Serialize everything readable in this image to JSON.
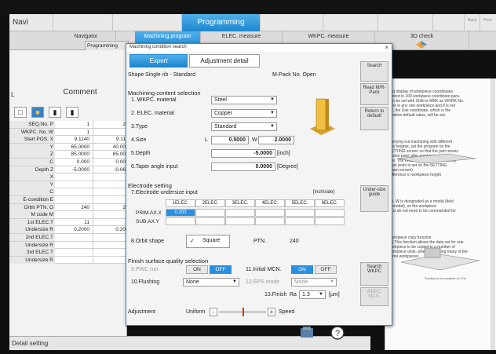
{
  "top_tabs": [
    "Navi",
    "",
    "",
    "",
    "Programming",
    "",
    "",
    "",
    "Back",
    "Print"
  ],
  "sub_tabs": [
    "Navigator",
    "Machining program",
    "ELEC. measure",
    "WKPC. measure",
    "3D check"
  ],
  "sub_sub": "Programming",
  "left": {
    "title": "Comment",
    "rows": [
      {
        "label": "SEQ.No. P",
        "c1": "1",
        "c2": "2"
      },
      {
        "label": "WKPC. No. W",
        "c1": "1",
        "c2": ""
      },
      {
        "label": "Start POS. X",
        "c1": "9.1140",
        "c2": "9.11"
      },
      {
        "label": "Y",
        "c1": "65.0000",
        "c2": "40.00"
      },
      {
        "label": "Z",
        "c1": "85.0000",
        "c2": "85.00"
      },
      {
        "label": "C",
        "c1": "0.000",
        "c2": "0.00"
      },
      {
        "label": "Depth Z",
        "c1": "-5.0000",
        "c2": "-0.06"
      },
      {
        "label": "X",
        "c1": "",
        "c2": ""
      },
      {
        "label": "Y",
        "c1": "",
        "c2": ""
      },
      {
        "label": "C",
        "c1": "",
        "c2": ""
      },
      {
        "label": "E-condition E",
        "c1": "",
        "c2": ""
      },
      {
        "label": "Orbit PTN. O",
        "c1": "240",
        "c2": "2"
      },
      {
        "label": "M code M",
        "c1": "",
        "c2": ""
      },
      {
        "label": "1st ELEC.T",
        "c1": "11",
        "c2": ""
      },
      {
        "label": "Undersize R",
        "c1": "0.2000",
        "c2": "0.20"
      },
      {
        "label": "2nd ELEC.T",
        "c1": "",
        "c2": ""
      },
      {
        "label": "Undersize R",
        "c1": "",
        "c2": ""
      },
      {
        "label": "3rd ELEC.T",
        "c1": "",
        "c2": ""
      },
      {
        "label": "Undersize R",
        "c1": "",
        "c2": ""
      }
    ],
    "footer": "Detail setting"
  },
  "dialog": {
    "title": "Machining condition search",
    "tab_expert": "Expert",
    "tab_adjust": "Adjustment detail",
    "shape": "Shape  Single rib - Standard",
    "mpack": "M-Pack No. Open",
    "section1": "Machining content selection",
    "wkpc_label": "1. WKPC. material",
    "wkpc_val": "Steel",
    "elec_label": "2. ELEC. material",
    "elec_val": "Copper",
    "type_label": "3.Type",
    "type_val": "Standard",
    "size_label": "4.Size",
    "size_l": "L",
    "size_l_val": "0.5000",
    "size_w": "W",
    "size_w_val": "2.0000",
    "depth_label": "5.Depth",
    "depth_val": "-5.0000",
    "depth_unit": "[inch]",
    "taper_label": "6.Taper angle input",
    "taper_val": "0.0000",
    "taper_unit": "[Degree]",
    "elec_setting": "Electrode setting",
    "undersize_label": "7.Electrode undersize input",
    "undersize_unit": "[inch/side]",
    "elec_cols": [
      "1ELEC.",
      "2ELEC.",
      "3ELEC.",
      "4ELEC.",
      "5ELEC.",
      "6ELEC."
    ],
    "row_prim": "PRIM.AX.X",
    "row_prim_val": "0.200",
    "row_sub": "SUB.AX.Y",
    "orbit_label": "8.Orbit shape",
    "orbit_val": "Square",
    "ptn_label": "PTN.",
    "ptn_val": "240",
    "finish_title": "Finish surface quality selection",
    "pwc_label": "9.PWC run",
    "on": "ON",
    "off": "OFF",
    "initial_label": "11.Initial MCN.",
    "flush_label": "10.Flushing",
    "flush_val": "None",
    "eps_label": "12.EPS mode",
    "eps_val": "Mode",
    "finish_label": "13.Finish",
    "ra_label": "Ra",
    "ra_val": "1.3",
    "ra_unit": "[µm]",
    "adjust_label": "Adjustment",
    "uniform": "Uniform",
    "minus": "-",
    "plus": "+",
    "speed": "Speed",
    "rbtns": [
      "Search",
      "Read M/R-Pack",
      "Return to default",
      "Under-size guide",
      "Search WKPC",
      "WKPC. MCN."
    ]
  },
  "doc": {
    "lines": [
      "Z)",
      "and display of workpiece coordinates",
      "Stored in 100 workpiece coordinate para.",
      "can be set with Shift to WRK as WORK No.",
      "here is any one workpiece and if is not",
      "ed, the Use coordinate, which is the",
      "position default value, will be set.",
      "",
      "Carrying out machining with different",
      "ace heights, set the program on the",
      "SETTING screen so that the part moves",
      "ession point after machining the lower",
      "ace. The evasion point after machining",
      "ower point is set on the SETTING",
      "(tham screen)",
      "",
      "Difference in workpiece height",
      "",
      "No. W is designated as a modal (field",
      "unmodal), so the workpiece",
      "atus do not need to be commanded for",
      "",
      "",
      "",
      "Workpiece copy function",
      "(a) This function allows the data set for one",
      "workpiece to be copied to a number of",
      "workpiece units, when machining many of the",
      "same workpieces."
    ],
    "fig_label": "Traction is for material of 4.0s"
  }
}
